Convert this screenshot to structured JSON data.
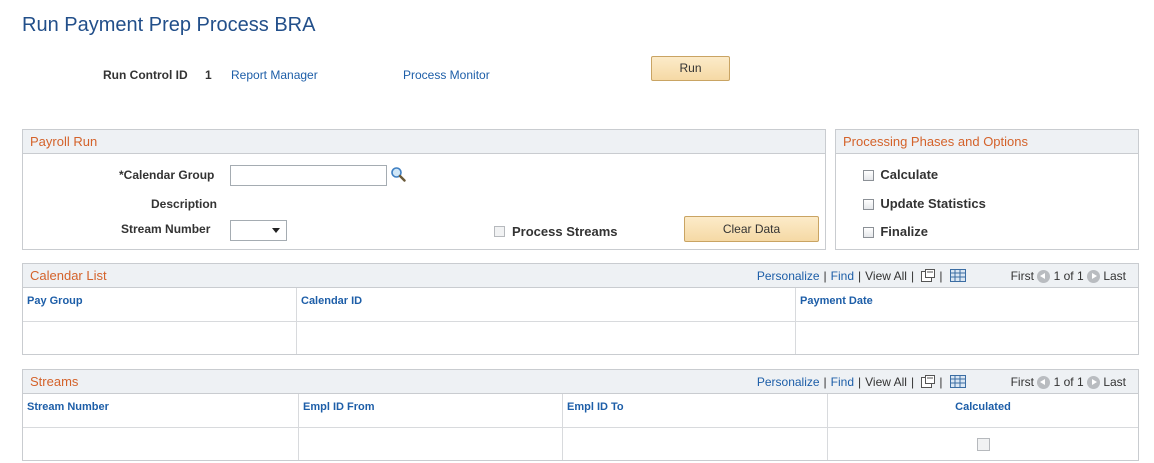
{
  "page": {
    "title": "Run Payment Prep Process BRA"
  },
  "run_control": {
    "label": "Run Control ID",
    "value": "1",
    "report_manager": "Report Manager",
    "process_monitor": "Process Monitor",
    "run_button": "Run"
  },
  "payroll_run": {
    "title": "Payroll Run",
    "calendar_group_label": "*Calendar Group",
    "calendar_group_value": "",
    "description_label": "Description",
    "stream_number_label": "Stream Number",
    "stream_number_value": "",
    "process_streams_label": "Process Streams",
    "clear_data_button": "Clear Data"
  },
  "phases": {
    "title": "Processing Phases and Options",
    "options": [
      "Calculate",
      "Update Statistics",
      "Finalize"
    ]
  },
  "calendar_list": {
    "title": "Calendar List",
    "tools": {
      "personalize": "Personalize",
      "find": "Find",
      "view_all": "View All",
      "first": "First",
      "page": "1 of 1",
      "last": "Last"
    },
    "columns": [
      "Pay Group",
      "Calendar ID",
      "Payment Date"
    ]
  },
  "streams": {
    "title": "Streams",
    "tools": {
      "personalize": "Personalize",
      "find": "Find",
      "view_all": "View All",
      "first": "First",
      "page": "1 of 1",
      "last": "Last"
    },
    "columns": [
      "Stream Number",
      "Empl ID From",
      "Empl ID To",
      "Calculated"
    ]
  }
}
